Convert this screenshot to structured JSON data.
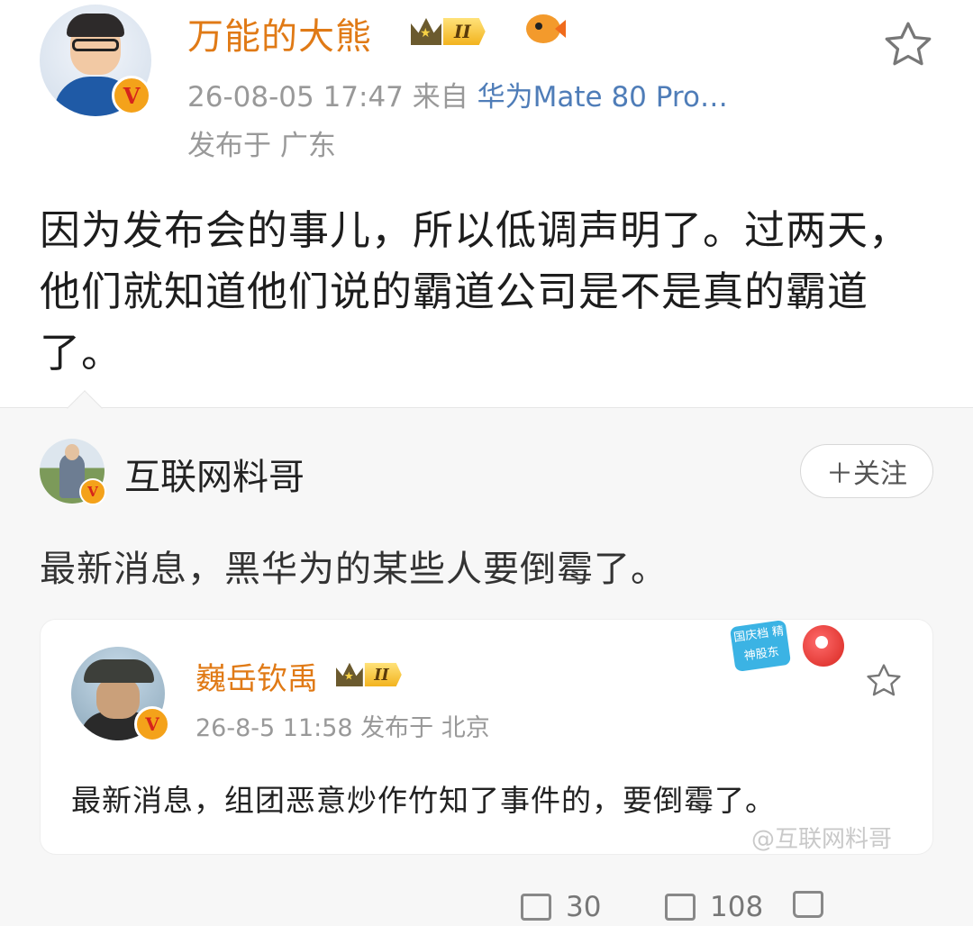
{
  "post": {
    "author": "万能的大熊",
    "level_badge": "II",
    "date": "26-08-05 17:47",
    "source_prefix": "来自",
    "source": "华为Mate 80 Pro…",
    "location": "发布于 广东",
    "verified_mark": "V",
    "text": "因为发布会的事儿，所以低调声明了。过两天，他们就知道他们说的霸道公司是不是真的霸道了。"
  },
  "repost": {
    "author": "互联网料哥",
    "verified_mark": "V",
    "follow_label": "＋关注",
    "text": "最新消息，黑华为的某些人要倒霉了。",
    "quoted": {
      "author": "巍岳钦禹",
      "level_badge": "II",
      "verified_mark": "V",
      "meta": "26-8-5 11:58  发布于 北京",
      "text": "最新消息，组团恶意炒作竹知了事件的，要倒霉了。",
      "holiday_badge": "国庆档 精神股东"
    },
    "watermark": "@互联网料哥"
  },
  "actions": {
    "repost_count": "30",
    "comment_count": "108",
    "like_count": ""
  },
  "colors": {
    "username": "#e07a16",
    "source_link": "#4f7db8",
    "meta_gray": "#999999",
    "repost_bg": "#f7f7f7"
  }
}
